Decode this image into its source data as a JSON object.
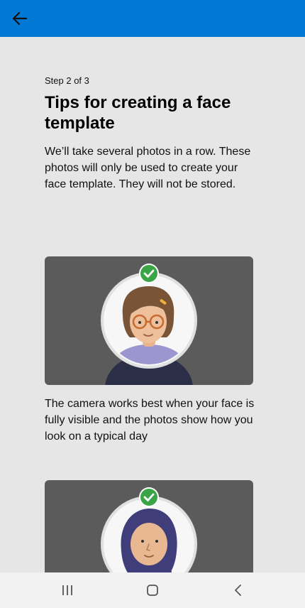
{
  "app_bar": {
    "back_icon": "arrow-left-icon",
    "color": "#0078d4"
  },
  "step_label": "Step 2 of 3",
  "title": "Tips for creating a face template",
  "description": "We’ll take several photos in a row. These photos will only be used to create your face template. They will not be stored.",
  "tips": [
    {
      "illustration": "face-glasses-illustration",
      "badge_icon": "check-circle-icon",
      "caption": "The camera works best when your face is fully visible and the photos show how you look on a typical day"
    },
    {
      "illustration": "face-hijab-illustration",
      "badge_icon": "check-circle-icon"
    }
  ],
  "system_nav": {
    "recents_icon": "recents-icon",
    "home_icon": "home-icon",
    "back_icon": "chevron-left-icon"
  }
}
